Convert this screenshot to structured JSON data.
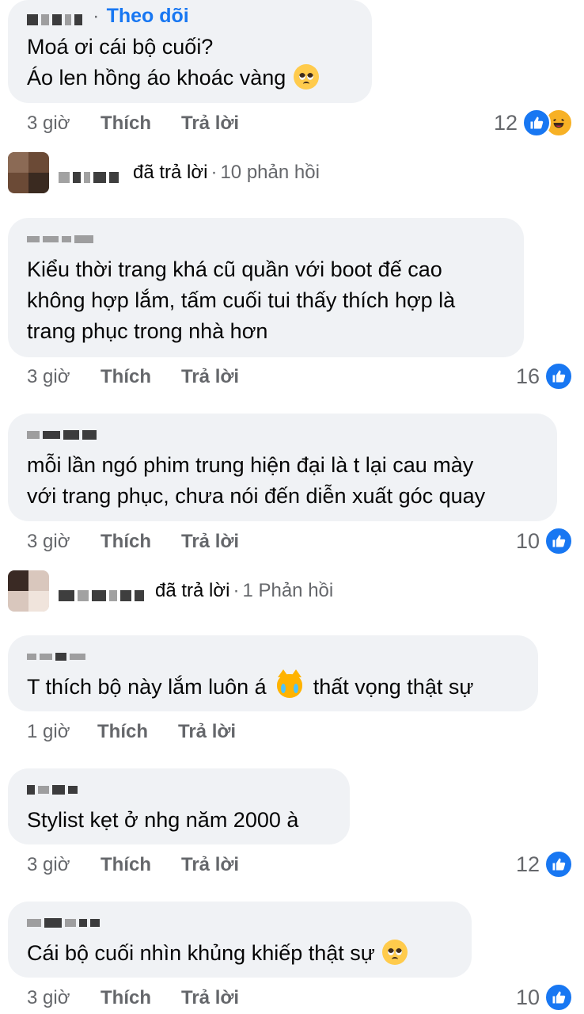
{
  "comments": [
    {
      "follow_label": "Theo dõi",
      "text_lines": [
        "Moá ơi cái bộ cuối?",
        "Áo len hồng áo khoác vàng"
      ],
      "time": "3 giờ",
      "like_label": "Thích",
      "reply_label": "Trả lời",
      "reaction_count": "12",
      "reactions": [
        "like-icon",
        "haha-icon"
      ]
    },
    {
      "text_lines": [
        "Kiểu thời trang khá cũ quần với boot đế cao",
        "không hợp lắm, tấm cuối tui thấy thích hợp là",
        "trang phục trong nhà hơn"
      ],
      "time": "3 giờ",
      "like_label": "Thích",
      "reply_label": "Trả lời",
      "reaction_count": "16"
    },
    {
      "text_lines": [
        "mỗi lần ngó phim trung hiện đại là t lại cau mày",
        "với trang phục, chưa nói đến diễn xuất góc quay"
      ],
      "time": "3 giờ",
      "like_label": "Thích",
      "reply_label": "Trả lời",
      "reaction_count": "10"
    },
    {
      "text_before": "T thích bộ này lắm luôn á",
      "text_after": "thất vọng thật sự",
      "time": "1 giờ",
      "like_label": "Thích",
      "reply_label": "Trả lời"
    },
    {
      "text_lines": [
        "Stylist kẹt ở nhg năm 2000 à"
      ],
      "time": "3 giờ",
      "like_label": "Thích",
      "reply_label": "Trả lời",
      "reaction_count": "12"
    },
    {
      "text_lines": [
        "Cái bộ cuối nhìn khủng khiếp thật sự"
      ],
      "time": "3 giờ",
      "like_label": "Thích",
      "reply_label": "Trả lời",
      "reaction_count": "10"
    }
  ],
  "reply_summaries": [
    {
      "action": "đã trả lời",
      "count_label": "10 phản hồi"
    },
    {
      "action": "đã trả lời",
      "count_label": "1 Phản hồi"
    }
  ],
  "colors": {
    "link_blue": "#1877f2",
    "bubble_bg": "#f0f2f5",
    "meta_gray": "#65676b"
  }
}
